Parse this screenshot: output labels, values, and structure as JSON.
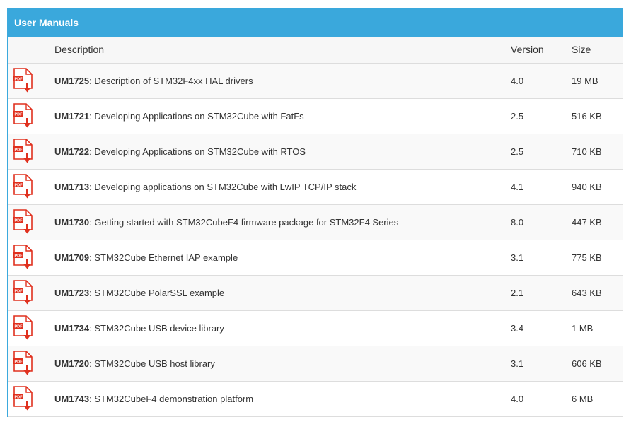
{
  "panel": {
    "title": "User Manuals"
  },
  "table": {
    "headers": {
      "description": "Description",
      "version": "Version",
      "size": "Size"
    },
    "rows": [
      {
        "icon": "pdf-download-icon",
        "code": "UM1725",
        "desc": ": Description of STM32F4xx HAL drivers",
        "version": "4.0",
        "size": "19 MB"
      },
      {
        "icon": "pdf-download-icon",
        "code": "UM1721",
        "desc": ": Developing Applications on STM32Cube with FatFs",
        "version": "2.5",
        "size": "516 KB"
      },
      {
        "icon": "pdf-download-icon",
        "code": "UM1722",
        "desc": ": Developing Applications on STM32Cube with RTOS",
        "version": "2.5",
        "size": "710 KB"
      },
      {
        "icon": "pdf-download-icon",
        "code": "UM1713",
        "desc": ": Developing applications on STM32Cube with LwIP TCP/IP stack",
        "version": "4.1",
        "size": "940 KB"
      },
      {
        "icon": "pdf-download-icon",
        "code": "UM1730",
        "desc": ": Getting started with STM32CubeF4 firmware package for STM32F4 Series",
        "version": "8.0",
        "size": "447 KB"
      },
      {
        "icon": "pdf-download-icon",
        "code": "UM1709",
        "desc": ": STM32Cube Ethernet IAP example",
        "version": "3.1",
        "size": "775 KB"
      },
      {
        "icon": "pdf-download-icon",
        "code": "UM1723",
        "desc": ": STM32Cube PolarSSL example",
        "version": "2.1",
        "size": "643 KB"
      },
      {
        "icon": "pdf-download-icon",
        "code": "UM1734",
        "desc": ": STM32Cube USB device library",
        "version": "3.4",
        "size": "1 MB"
      },
      {
        "icon": "pdf-download-icon",
        "code": "UM1720",
        "desc": ": STM32Cube USB host library",
        "version": "3.1",
        "size": "606 KB"
      },
      {
        "icon": "pdf-download-icon",
        "code": "UM1743",
        "desc": ": STM32CubeF4 demonstration platform",
        "version": "4.0",
        "size": "6 MB"
      }
    ]
  },
  "colors": {
    "header_bg": "#3aa8dc",
    "header_text": "#ffffff",
    "pdf_red": "#e0301e",
    "row_border": "#dddddd"
  }
}
